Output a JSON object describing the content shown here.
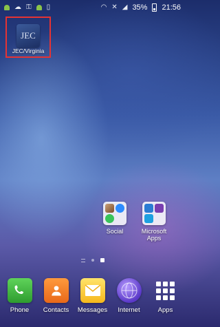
{
  "status_bar": {
    "battery": "35%",
    "time": "21:56",
    "icons_left": [
      "android-icon",
      "cloud-icon",
      "key-icon",
      "android-icon",
      "clipboard-icon"
    ],
    "icons_right": [
      "wifi-icon",
      "mute-icon",
      "signal-icon",
      "battery-icon"
    ]
  },
  "home": {
    "jec_app": {
      "label": "JEC/Virginia",
      "icon_text": "JEC"
    },
    "folders": [
      {
        "label": "Social"
      },
      {
        "label_line1": "Microsoft",
        "label_line2": "Apps"
      }
    ]
  },
  "dock": {
    "items": [
      {
        "label": "Phone"
      },
      {
        "label": "Contacts"
      },
      {
        "label": "Messages"
      },
      {
        "label": "Internet"
      },
      {
        "label": "Apps"
      }
    ]
  },
  "colors": {
    "highlight_border": "#e63333",
    "phone": "#3cb93c",
    "contacts": "#f07a22",
    "messages": "#f8c930",
    "internet": "#6a45d6"
  }
}
